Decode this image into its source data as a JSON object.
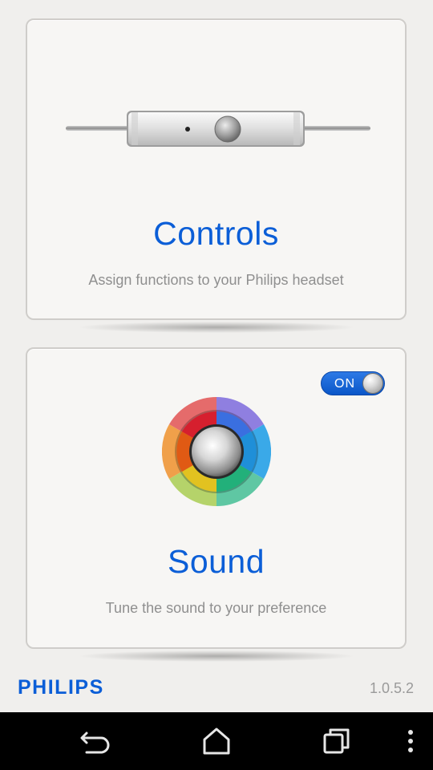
{
  "cards": {
    "controls": {
      "title": "Controls",
      "subtitle": "Assign functions to your Philips headset"
    },
    "sound": {
      "title": "Sound",
      "subtitle": "Tune the sound to your preference",
      "toggle_label": "ON",
      "toggle_state": "on"
    }
  },
  "footer": {
    "brand": "PHILIPS",
    "version": "1.0.5.2"
  },
  "navbar": {
    "buttons": [
      "back-icon",
      "home-icon",
      "recent-apps-icon",
      "overflow-menu-icon"
    ]
  },
  "colors": {
    "accent": "#0b5ed7",
    "background": "#f0efed",
    "card": "#f7f6f4",
    "navbar": "#000000"
  }
}
